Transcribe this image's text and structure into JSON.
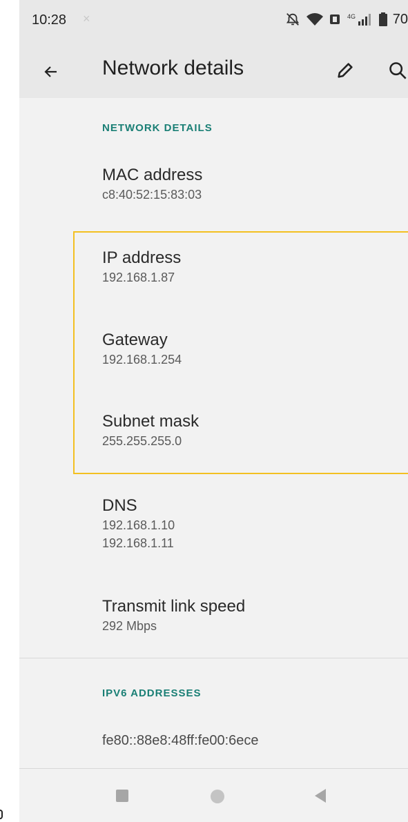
{
  "status_bar": {
    "time": "10:28",
    "notification_glyph": "×",
    "icons": [
      "alarm-off-icon",
      "wifi-icon",
      "nfc-icon",
      "4g-signal-icon",
      "battery-icon"
    ],
    "battery": "70"
  },
  "app_bar": {
    "title": "Network details",
    "back_icon": "arrow-left-icon",
    "edit_icon": "pencil-icon",
    "search_icon": "search-icon"
  },
  "sections": {
    "network_details_header": "NETWORK DETAILS",
    "mac": {
      "label": "MAC address",
      "value": "c8:40:52:15:83:03"
    },
    "ip": {
      "label": "IP address",
      "value": "192.168.1.87"
    },
    "gateway": {
      "label": "Gateway",
      "value": "192.168.1.254"
    },
    "subnet": {
      "label": "Subnet mask",
      "value": "255.255.255.0"
    },
    "dns": {
      "label": "DNS",
      "values": [
        "192.168.1.10",
        "192.168.1.11"
      ]
    },
    "link_speed": {
      "label": "Transmit link speed",
      "value": "292 Mbps"
    },
    "ipv6_header": "IPV6 ADDRESSES",
    "ipv6_value": "fe80::88e8:48ff:fe00:6ece"
  },
  "colors": {
    "accent_teal": "#1a7f75",
    "highlight_yellow": "#f3c021",
    "bar_background": "#e8e8e8",
    "content_background": "#f2f2f2"
  },
  "nav_bar": {
    "icons": [
      "recents-square-icon",
      "home-circle-icon",
      "back-triangle-icon"
    ]
  }
}
